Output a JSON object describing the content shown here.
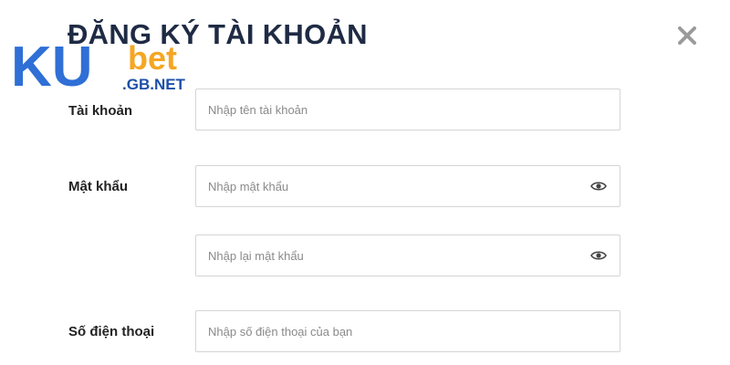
{
  "dialog": {
    "title": "ĐĂNG KÝ TÀI KHOẢN",
    "close_icon": "close-icon"
  },
  "logo": {
    "brand_ku": "KU",
    "brand_bet": "bet",
    "domain": ".GB.NET",
    "colors": {
      "ku": "#2f6fd6",
      "bet": "#f5a623",
      "domain_text": "#1e4fa8"
    }
  },
  "form": {
    "account": {
      "label": "Tài khoản",
      "placeholder": "Nhập tên tài khoản",
      "value": ""
    },
    "password": {
      "label": "Mật khẩu",
      "placeholder": "Nhập mật khẩu",
      "value": "",
      "toggle_icon": "eye-icon"
    },
    "confirm_password": {
      "placeholder": "Nhập lại mật khẩu",
      "value": "",
      "toggle_icon": "eye-icon"
    },
    "phone": {
      "label": "Số điện thoại",
      "placeholder": "Nhập số điện thoại của bạn",
      "value": ""
    }
  }
}
